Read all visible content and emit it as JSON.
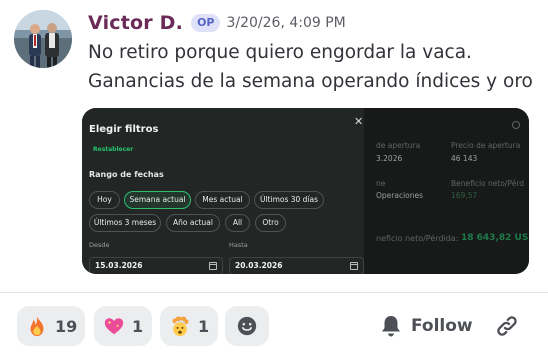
{
  "post": {
    "author": "Victor D.",
    "badge": "OP",
    "timestamp": "3/20/26, 4:09 PM",
    "message_lines": [
      "No retiro porque quiero engordar la vaca.",
      "Ganancias de la semana operando índices y oro"
    ]
  },
  "embed": {
    "filter_panel": {
      "title": "Elegir filtros",
      "close_icon": "close-icon",
      "reset_label": "Restablecer",
      "date_range_label": "Rango de fechas",
      "chips": [
        {
          "label": "Hoy",
          "active": false
        },
        {
          "label": "Semana actual",
          "active": true
        },
        {
          "label": "Mes actual",
          "active": false
        },
        {
          "label": "Últimos 30 días",
          "active": false
        },
        {
          "label": "Últimos 3 meses",
          "active": false
        },
        {
          "label": "Año actual",
          "active": false
        },
        {
          "label": "All",
          "active": false
        },
        {
          "label": "Otro",
          "active": false
        }
      ],
      "from_label": "Desde",
      "from_value": "15.03.2026",
      "to_label": "Hasta",
      "to_value": "20.03.2026"
    },
    "background": {
      "open_date_label": "de apertura",
      "open_date_value": "3.2026",
      "open_price_label": "Precio de apertura",
      "open_price_value": "46 143",
      "ops_label": "Operaciones",
      "ops_prefix": "ne",
      "net_profit_label": "Beneficio neto/Pérd",
      "net_profit_value": "169,57",
      "total_label": "neficio neto/Pérdida:",
      "total_value": "18 643,82 USD"
    }
  },
  "reactions": [
    {
      "icon": "fire-emoji",
      "count": "19"
    },
    {
      "icon": "sparkling-heart-emoji",
      "count": "1"
    },
    {
      "icon": "exploding-head-emoji",
      "count": "1"
    }
  ],
  "actions": {
    "add_reaction_icon": "add-reaction-icon",
    "follow_icon": "bell-icon",
    "follow_label": "Follow",
    "link_icon": "link-icon"
  },
  "colors": {
    "author": "#6b2a57",
    "badge_bg": "#dfe1f9",
    "badge_text": "#5865c7",
    "accent_green": "#25c26b",
    "reaction_bg": "#ebedef"
  }
}
